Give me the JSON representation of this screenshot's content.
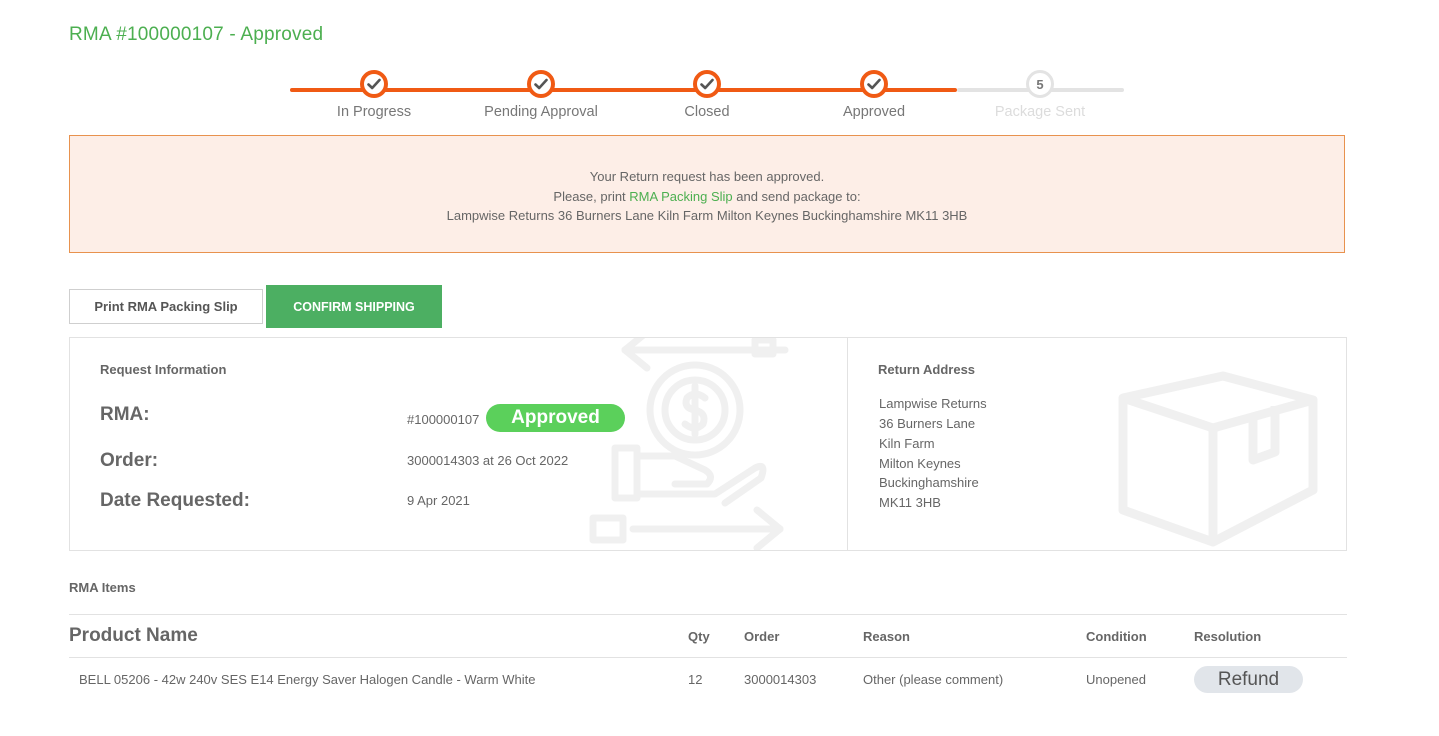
{
  "page": {
    "title": "RMA #100000107 - Approved"
  },
  "progress": {
    "steps": [
      {
        "label": "In Progress",
        "state": "done",
        "icon": "check-icon"
      },
      {
        "label": "Pending Approval",
        "state": "done",
        "icon": "check-icon"
      },
      {
        "label": "Closed",
        "state": "done",
        "icon": "check-icon"
      },
      {
        "label": "Approved",
        "state": "done",
        "icon": "check-icon"
      },
      {
        "label": "Package Sent",
        "state": "todo",
        "number": "5"
      }
    ]
  },
  "notice": {
    "line1": "Your Return request has been approved.",
    "line2_prefix": "Please, print",
    "line2_link": "RMA Packing Slip",
    "line2_suffix": "and send package to:",
    "address": "Lampwise Returns 36 Burners Lane Kiln Farm Milton Keynes Buckinghamshire MK11 3HB"
  },
  "actions": {
    "print_label": "Print RMA Packing Slip",
    "confirm_label": "CONFIRM SHIPPING"
  },
  "request_info": {
    "heading": "Request Information",
    "rma_label": "RMA:",
    "rma_value": "#100000107",
    "status_badge": "Approved",
    "order_label": "Order:",
    "order_value": "3000014303 at 26 Oct 2022",
    "date_label": "Date Requested:",
    "date_value": "9 Apr 2021"
  },
  "return_address": {
    "heading": "Return Address",
    "lines": [
      "Lampwise Returns",
      "36 Burners Lane",
      "Kiln Farm",
      "Milton Keynes",
      "Buckinghamshire",
      "MK11 3HB"
    ]
  },
  "items": {
    "title": "RMA Items",
    "columns": {
      "product": "Product Name",
      "qty": "Qty",
      "order": "Order",
      "reason": "Reason",
      "condition": "Condition",
      "resolution": "Resolution"
    },
    "rows": [
      {
        "product": "BELL 05206 - 42w 240v SES E14 Energy Saver Halogen Candle - Warm White",
        "qty": "12",
        "order": "3000014303",
        "reason": "Other (please comment)",
        "condition": "Unopened",
        "resolution": "Refund"
      }
    ]
  },
  "colors": {
    "accent_green": "#4caf50",
    "progress_orange": "#f05a14",
    "notice_bg": "#fdeee7",
    "notice_border": "#e8924e",
    "badge_green": "#5bd05b"
  }
}
